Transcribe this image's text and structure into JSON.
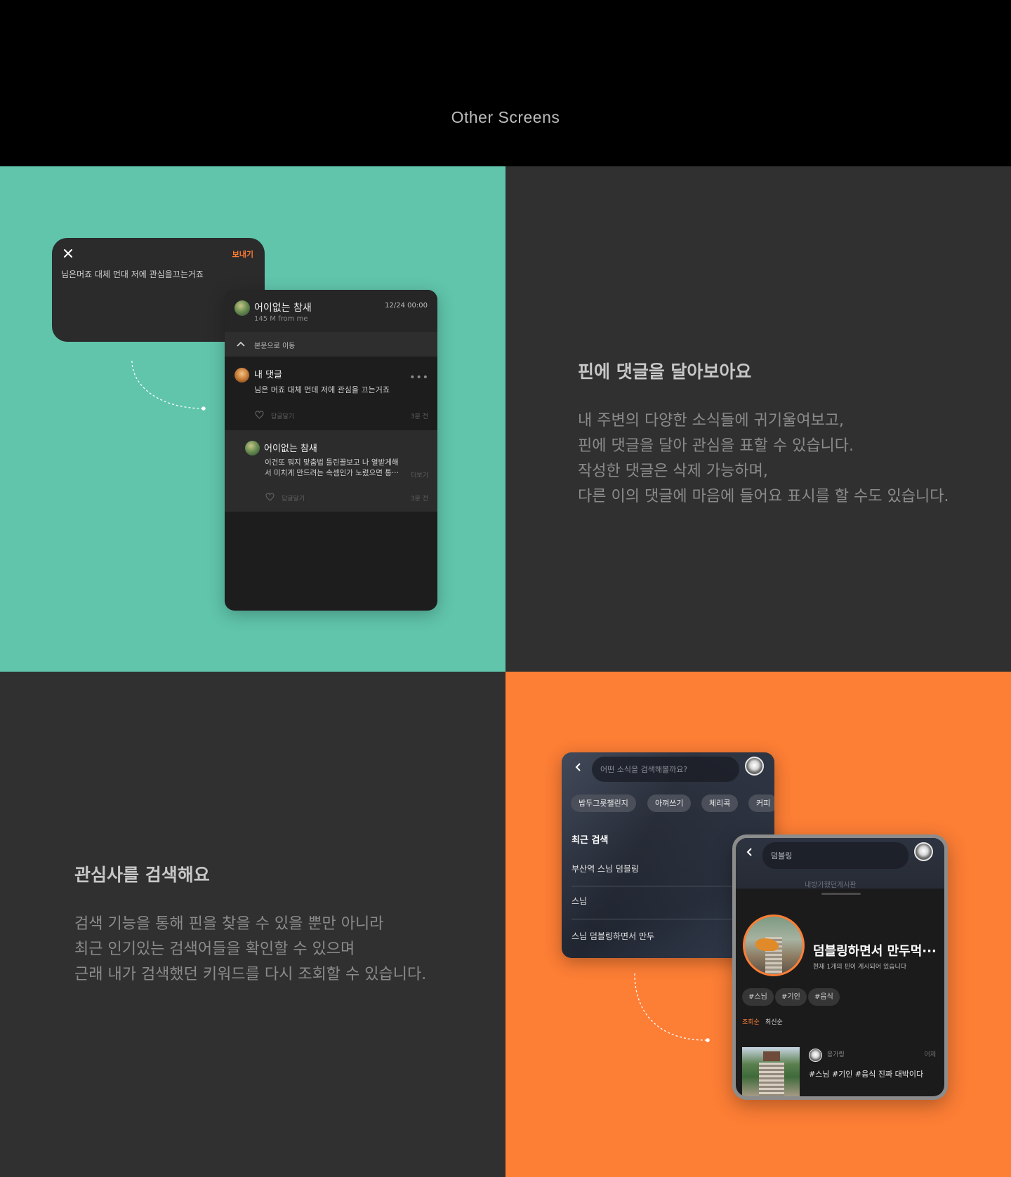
{
  "header": {
    "title": "Other Screens"
  },
  "comment_section": {
    "title": "핀에 댓글을 달아보아요",
    "description": [
      "내 주변의 다양한 소식들에 귀기울여보고,",
      "핀에 댓글을 달아 관심을 표할 수 있습니다.",
      "작성한 댓글은 삭제 가능하며,",
      "다른 이의 댓글에 마음에 들어요 표시를 할 수도 있습니다."
    ],
    "write_card": {
      "send_label": "보내기",
      "text": "님은머죠 대체 먼대 저에 관심을끄는거죠"
    },
    "post_card": {
      "author": "어이없는 참새",
      "distance": "145 M from me",
      "timestamp": "12/24 00:00",
      "back_to_post": "본문으로 이동",
      "comments": [
        {
          "author": "내 댓글",
          "text": "님은 머죠 대체 먼데 저에 관심을 끄는거죠",
          "reply_label": "답글달기",
          "time": "3분 전"
        },
        {
          "author": "어이없는 참새",
          "text_line1": "이건또 뭐지 맞춤법 틀린꼴보고 나 열받게해",
          "text_line2": "서 미치게 만드려는 속셈인가 노렸으면 통···",
          "more_label": "더보기",
          "reply_label": "답글달기",
          "time": "3분 전"
        }
      ]
    }
  },
  "search_section": {
    "title": "관심사를 검색해요",
    "description": [
      "검색 기능을 통해 핀을 찾을 수 있을 뿐만 아니라",
      "최근 인기있는 검색어들을 확인할 수 있으며",
      "근래 내가 검색했던 키워드를 다시 조회할 수 있습니다."
    ],
    "search_card": {
      "placeholder": "어떤 소식을 검색해볼까요?",
      "chips": [
        "밥두그릇챌린지",
        "아껴쓰기",
        "체리콕",
        "커피"
      ],
      "recent_title": "최근 검색",
      "recent_items": [
        "부산역 스님 덤블링",
        "스님",
        "스님 덤블링하면서 만두"
      ]
    },
    "detail_card": {
      "query": "덤블링",
      "ghost_text": "내방가했던게시판",
      "title": "덤블링하면서 만두먹···",
      "subtitle": "현재 1개의 핀이 게시되어 있습니다",
      "tags": [
        "#스님",
        "#기인",
        "#음식"
      ],
      "sort_popular": "조회순",
      "sort_recent": "최신순",
      "post": {
        "user": "응가링",
        "date": "어제",
        "text": "#스님 #기인 #음식 진짜 대박이다"
      }
    }
  },
  "colors": {
    "teal": "#60c5ab",
    "orange": "#fd7e35",
    "dark": "#303030",
    "accent_text": "#ff7a33"
  }
}
